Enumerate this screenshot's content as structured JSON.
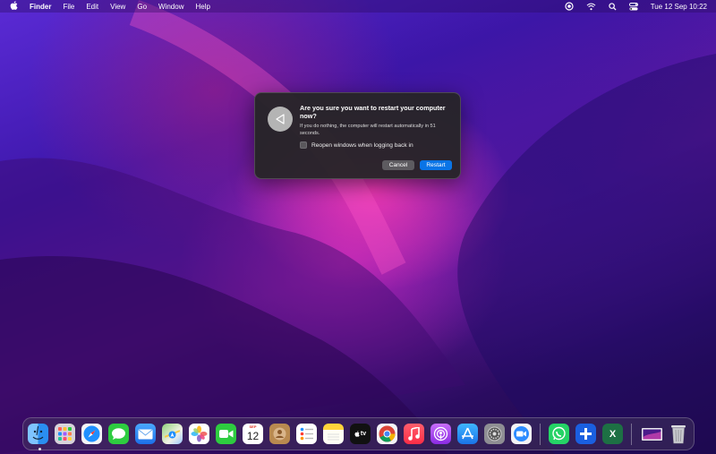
{
  "menubar": {
    "apple": "",
    "app": "Finder",
    "menus": [
      "File",
      "Edit",
      "View",
      "Go",
      "Window",
      "Help"
    ],
    "icons": [
      "screen-record-icon",
      "wifi-icon",
      "search-icon",
      "control-center-icon"
    ],
    "clock": "Tue 12 Sep  10:22"
  },
  "dialog": {
    "title": "Are you sure you want to restart your computer now?",
    "message": "If you do nothing, the computer will restart automatically in 51 seconds.",
    "reopen_label": "Reopen windows when logging back in",
    "reopen_checked": false,
    "cancel_label": "Cancel",
    "restart_label": "Restart",
    "icon": "restart-arrow-icon"
  },
  "dock": {
    "calendar": {
      "month": "SEP",
      "day": "12"
    },
    "appletv_label": "tv",
    "excel_label": "X",
    "items": [
      "Finder",
      "Launchpad",
      "Safari",
      "Messages",
      "Mail",
      "Maps",
      "Photos",
      "FaceTime",
      "Calendar",
      "Contacts",
      "Reminders",
      "Notes",
      "Apple TV",
      "Chrome",
      "Music",
      "Podcasts",
      "App Store",
      "System Settings",
      "Zoom",
      "WhatsApp",
      "Tembo",
      "Excel",
      "Downloads",
      "Trash"
    ]
  },
  "colors": {
    "accent_button": "#0a74e6",
    "dialog_bg": "#262428"
  }
}
